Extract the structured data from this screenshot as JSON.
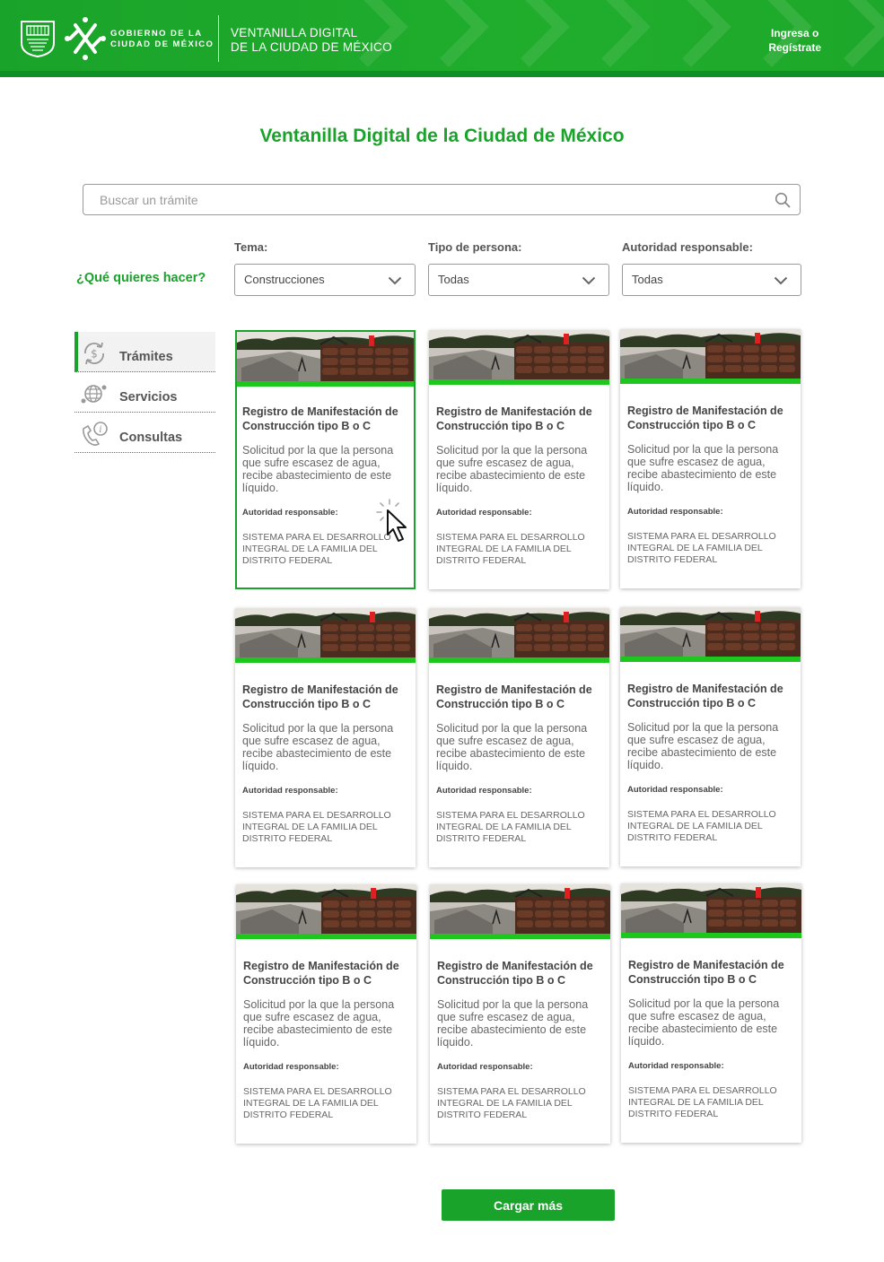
{
  "header": {
    "gov_name_line1": "GOBIERNO DE LA",
    "gov_name_line2": "CIUDAD DE MÉXICO",
    "portal_line1": "VENTANILLA DIGITAL",
    "portal_line2": "DE LA CIUDAD DE MÉXICO",
    "login_label": "Ingresa o",
    "register_label": "Regístrate"
  },
  "page_title": "Ventanilla Digital de la Ciudad de México",
  "search": {
    "placeholder": "Buscar un trámite",
    "value": ""
  },
  "filters": {
    "prompt": "¿Qué quieres hacer?",
    "tema": {
      "label": "Tema:",
      "value": "Construcciones"
    },
    "tipo_persona": {
      "label": "Tipo de persona:",
      "value": "Todas"
    },
    "autoridad": {
      "label": "Autoridad responsable:",
      "value": "Todas"
    }
  },
  "sidebar": {
    "items": [
      {
        "label": "Trámites",
        "icon": "money-exchange-icon",
        "active": true
      },
      {
        "label": "Servicios",
        "icon": "services-globe-icon",
        "active": false
      },
      {
        "label": "Consultas",
        "icon": "phone-info-icon",
        "active": false
      }
    ]
  },
  "cards": [
    {
      "title": "Registro de Manifestación de Construcción tipo B o C",
      "description": "Solicitud por la que la persona que sufre escasez de agua, recibe abastecimiento de este líquido.",
      "authority_label": "Autoridad responsable:",
      "authority": "SISTEMA PARA EL DESARROLLO INTEGRAL DE LA FAMILIA DEL DISTRITO FEDERAL"
    },
    {
      "title": "Registro de Manifestación de Construcción tipo B o C",
      "description": "Solicitud por la que la persona que sufre escasez de agua, recibe abastecimiento de este líquido.",
      "authority_label": "Autoridad responsable:",
      "authority": "SISTEMA PARA EL DESARROLLO INTEGRAL DE LA FAMILIA DEL DISTRITO FEDERAL"
    },
    {
      "title": "Registro de Manifestación de Construcción tipo B o C",
      "description": "Solicitud por la que la persona que sufre escasez de agua, recibe abastecimiento de este líquido.",
      "authority_label": "Autoridad responsable:",
      "authority": "SISTEMA PARA EL DESARROLLO INTEGRAL DE LA FAMILIA DEL DISTRITO FEDERAL"
    },
    {
      "title": "Registro de Manifestación de Construcción tipo B o C",
      "description": "Solicitud por la que la persona que sufre escasez de agua, recibe abastecimiento de este líquido.",
      "authority_label": "Autoridad responsable:",
      "authority": "SISTEMA PARA EL DESARROLLO INTEGRAL DE LA FAMILIA DEL DISTRITO FEDERAL"
    },
    {
      "title": "Registro de Manifestación de Construcción tipo B o C",
      "description": "Solicitud por la que la persona que sufre escasez de agua, recibe abastecimiento de este líquido.",
      "authority_label": "Autoridad responsable:",
      "authority": "SISTEMA PARA EL DESARROLLO INTEGRAL DE LA FAMILIA DEL DISTRITO FEDERAL"
    },
    {
      "title": "Registro de Manifestación de Construcción tipo B o C",
      "description": "Solicitud por la que la persona que sufre escasez de agua, recibe abastecimiento de este líquido.",
      "authority_label": "Autoridad responsable:",
      "authority": "SISTEMA PARA EL DESARROLLO INTEGRAL DE LA FAMILIA DEL DISTRITO FEDERAL"
    },
    {
      "title": "Registro de Manifestación de Construcción tipo B o C",
      "description": "Solicitud por la que la persona que sufre escasez de agua, recibe abastecimiento de este líquido.",
      "authority_label": "Autoridad responsable:",
      "authority": "SISTEMA PARA EL DESARROLLO INTEGRAL DE LA FAMILIA DEL DISTRITO FEDERAL"
    },
    {
      "title": "Registro de Manifestación de Construcción tipo B o C",
      "description": "Solicitud por la que la persona que sufre escasez de agua, recibe abastecimiento de este líquido.",
      "authority_label": "Autoridad responsable:",
      "authority": "SISTEMA PARA EL DESARROLLO INTEGRAL DE LA FAMILIA DEL DISTRITO FEDERAL"
    },
    {
      "title": "Registro de Manifestación de Construcción tipo B o C",
      "description": "Solicitud por la que la persona que sufre escasez de agua, recibe abastecimiento de este líquido.",
      "authority_label": "Autoridad responsable:",
      "authority": "SISTEMA PARA EL DESARROLLO INTEGRAL DE LA FAMILIA DEL DISTRITO FEDERAL"
    }
  ],
  "load_more_label": "Cargar más",
  "colors": {
    "brand_green": "#1aa32a",
    "strip_green": "#1ec71e",
    "dark_green": "#0f8f24"
  }
}
